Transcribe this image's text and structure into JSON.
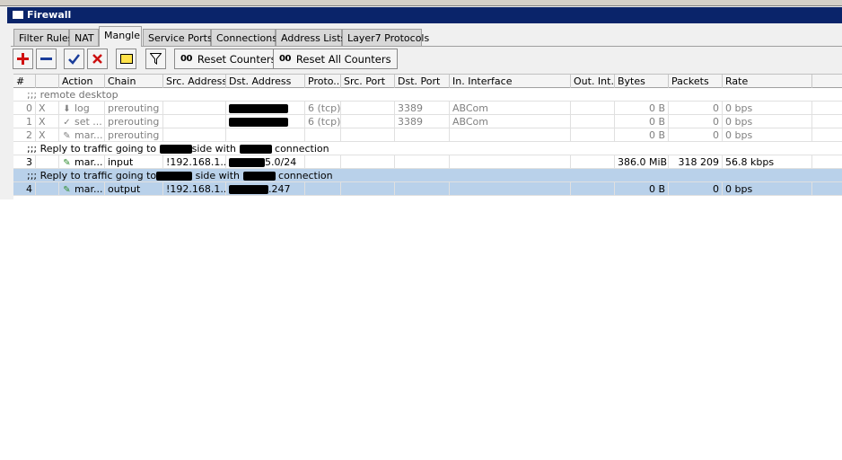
{
  "window": {
    "title": "Firewall"
  },
  "tabs": [
    {
      "label": "Filter Rules"
    },
    {
      "label": "NAT"
    },
    {
      "label": "Mangle"
    },
    {
      "label": "Service Ports"
    },
    {
      "label": "Connections"
    },
    {
      "label": "Address Lists"
    },
    {
      "label": "Layer7 Protocols"
    }
  ],
  "toolbar": {
    "reset_counters": "Reset Counters",
    "reset_all_counters": "Reset All Counters",
    "counter_prefix": "00"
  },
  "columns": [
    "#",
    "",
    "Action",
    "Chain",
    "Src. Address",
    "Dst. Address",
    "Proto...",
    "Src. Port",
    "Dst. Port",
    "In. Interface",
    "Out. Int...",
    "Bytes",
    "Packets",
    "Rate"
  ],
  "rows": {
    "c1": {
      "comment": ";;; remote desktop"
    },
    "r0": {
      "num": "0",
      "flag": "X",
      "action": "log",
      "chain": "prerouting",
      "proto": "6 (tcp)",
      "dst_port": "3389",
      "in_iface": "ABCom",
      "bytes": "0 B",
      "packets": "0",
      "rate": "0 bps"
    },
    "r1": {
      "num": "1",
      "flag": "X",
      "action": "set ...",
      "chain": "prerouting",
      "proto": "6 (tcp)",
      "dst_port": "3389",
      "in_iface": "ABCom",
      "bytes": "0 B",
      "packets": "0",
      "rate": "0 bps"
    },
    "r2": {
      "num": "2",
      "flag": "X",
      "action": "mar...",
      "chain": "prerouting",
      "bytes": "0 B",
      "packets": "0",
      "rate": "0 bps"
    },
    "c2": {
      "a": ";;; Reply to traffic going to",
      "b": "side with",
      "c": "connection"
    },
    "r3": {
      "num": "3",
      "action": "mar...",
      "chain": "input",
      "src": "!192.168.1....",
      "dst_tail": "5.0/24",
      "bytes": "386.0 MiB",
      "packets": "318 209",
      "rate": "56.8 kbps"
    },
    "c3": {
      "a": ";;; Reply to traffic going to",
      "b": "side with",
      "c": "connection"
    },
    "r4": {
      "num": "4",
      "action": "mar...",
      "chain": "output",
      "src": "!192.168.1....",
      "dst_tail": ".247",
      "bytes": "0 B",
      "packets": "0",
      "rate": "0 bps"
    }
  }
}
